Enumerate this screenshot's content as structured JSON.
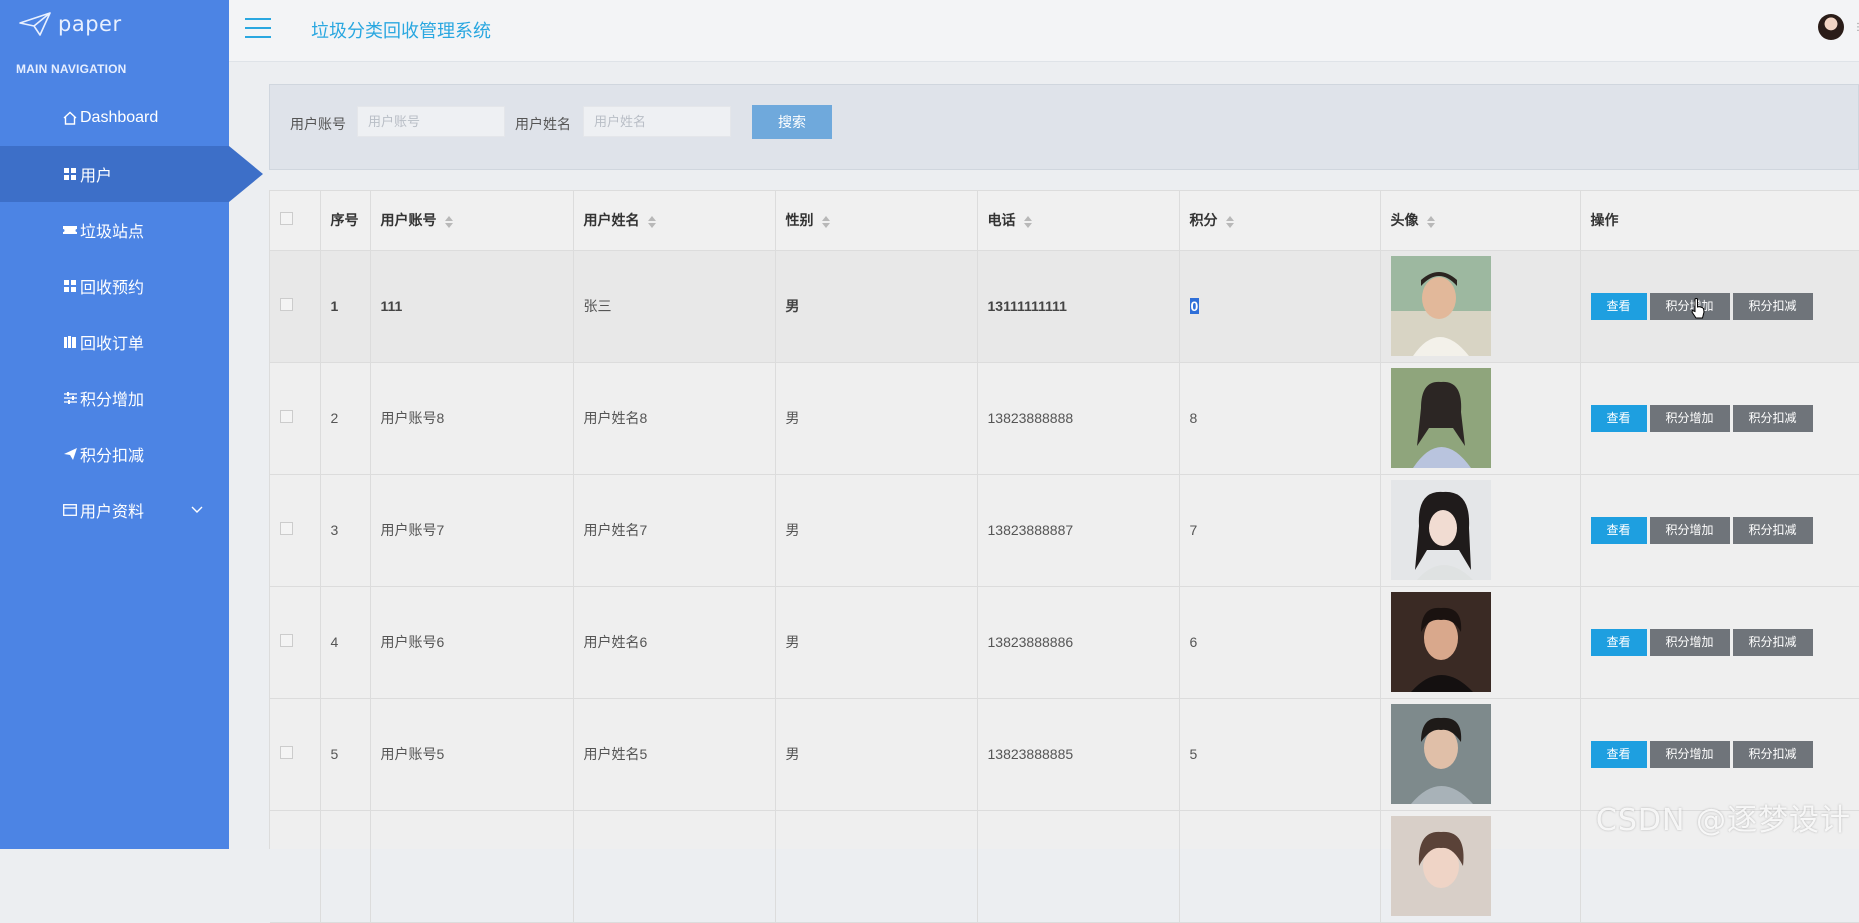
{
  "brand": {
    "logo_text": "paper",
    "logo_icon": "paper-plane-icon"
  },
  "sidebar": {
    "heading": "MAIN NAVIGATION",
    "items": [
      {
        "label": "Dashboard",
        "icon": "home-icon"
      },
      {
        "label": "用户",
        "icon": "grid-icon",
        "active": true
      },
      {
        "label": "垃圾站点",
        "icon": "ticket-icon"
      },
      {
        "label": "回收预约",
        "icon": "grid-icon"
      },
      {
        "label": "回收订单",
        "icon": "book-icon"
      },
      {
        "label": "积分增加",
        "icon": "sliders-icon"
      },
      {
        "label": "积分扣减",
        "icon": "send-icon"
      },
      {
        "label": "用户资料",
        "icon": "card-icon",
        "expandable": true
      }
    ]
  },
  "header": {
    "title": "垃圾分类回收管理系统"
  },
  "search": {
    "account_label": "用户账号",
    "account_placeholder": "用户账号",
    "name_label": "用户姓名",
    "name_placeholder": "用户姓名",
    "button_label": "搜索"
  },
  "table": {
    "columns": [
      "序号",
      "用户账号",
      "用户姓名",
      "性别",
      "电话",
      "积分",
      "头像",
      "操作"
    ],
    "rows": [
      {
        "no": "1",
        "account": "111",
        "name": "张三",
        "gender": "男",
        "phone": "13111111111",
        "points": "0"
      },
      {
        "no": "2",
        "account": "用户账号8",
        "name": "用户姓名8",
        "gender": "男",
        "phone": "13823888888",
        "points": "8"
      },
      {
        "no": "3",
        "account": "用户账号7",
        "name": "用户姓名7",
        "gender": "男",
        "phone": "13823888887",
        "points": "7"
      },
      {
        "no": "4",
        "account": "用户账号6",
        "name": "用户姓名6",
        "gender": "男",
        "phone": "13823888886",
        "points": "6"
      },
      {
        "no": "5",
        "account": "用户账号5",
        "name": "用户姓名5",
        "gender": "男",
        "phone": "13823888885",
        "points": "5"
      }
    ],
    "actions": {
      "view": "查看",
      "add_points": "积分增加",
      "deduct_points": "积分扣减"
    }
  },
  "watermark": "CSDN @逐梦设计",
  "colors": {
    "sidebar": "#4c84e4",
    "accent": "#2aa7e0",
    "view_button": "#1e9fe0",
    "action_button": "#6f747a"
  }
}
